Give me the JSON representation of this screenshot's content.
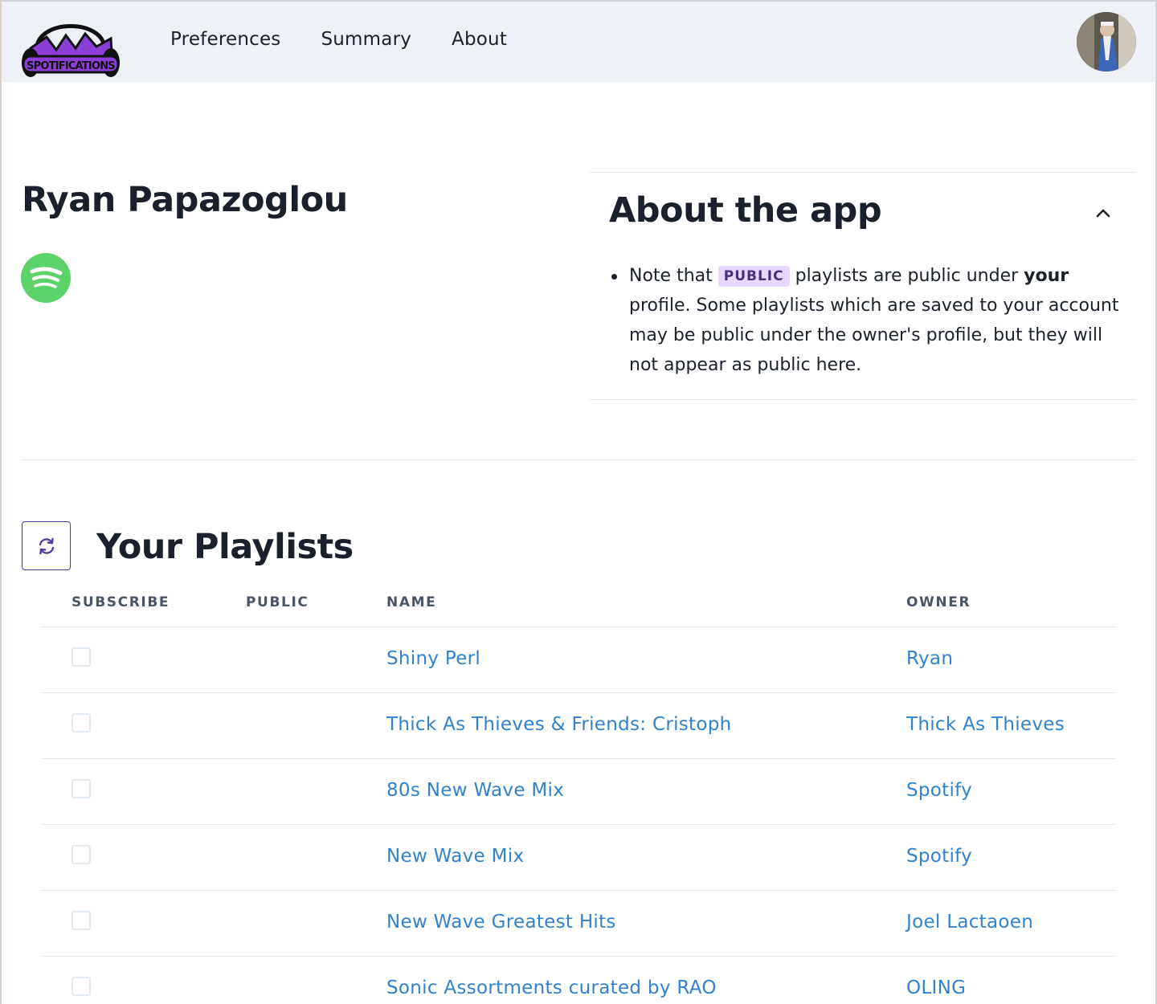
{
  "colors": {
    "navbar_bg": "#edf1f6",
    "accent_purple": "#553c9a",
    "badge_bg": "#e9d8fd",
    "badge_text": "#44337a",
    "link_blue": "#3182ce",
    "spotify_green": "#5bd26a"
  },
  "navbar": {
    "logo_text": "SPOTIFICATIONS",
    "links": [
      "Preferences",
      "Summary",
      "About"
    ],
    "avatar_icon": "user-avatar"
  },
  "profile": {
    "name": "Ryan Papazoglou",
    "service_icon": "spotify-icon"
  },
  "about": {
    "title": "About the app",
    "toggle_icon": "chevron-up-icon",
    "note_prefix": "Note that",
    "badge": "PUBLIC",
    "note_middle": "playlists are public under",
    "note_bold": "your",
    "note_suffix": "profile. Some playlists which are saved to your account may be public under the owner's profile, but they will not appear as public here."
  },
  "playlists": {
    "refresh_icon": "refresh-icon",
    "title": "Your Playlists",
    "columns": {
      "subscribe": "SUBSCRIBE",
      "public": "PUBLIC",
      "name": "NAME",
      "owner": "OWNER"
    },
    "rows": [
      {
        "name": "Shiny Perl",
        "owner": "Ryan"
      },
      {
        "name": "Thick As Thieves & Friends: Cristoph",
        "owner": "Thick As Thieves"
      },
      {
        "name": "80s New Wave Mix",
        "owner": "Spotify"
      },
      {
        "name": "New Wave Mix",
        "owner": "Spotify"
      },
      {
        "name": "New Wave Greatest Hits",
        "owner": "Joel Lactaoen"
      },
      {
        "name": "Sonic Assortments curated by RAO",
        "owner": "OLING"
      }
    ]
  }
}
